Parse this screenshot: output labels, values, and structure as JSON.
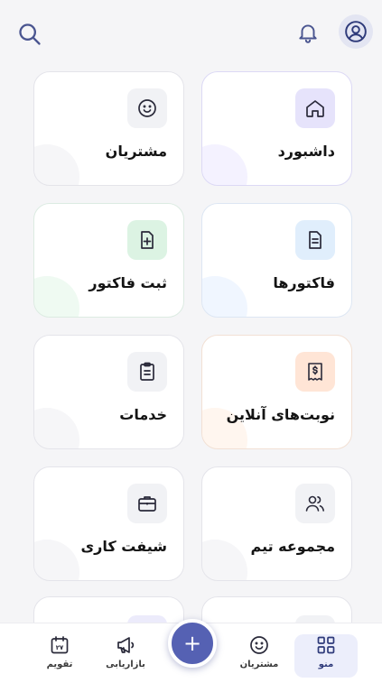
{
  "header": {
    "icons": [
      "search-icon",
      "bell-icon",
      "user-avatar-icon"
    ]
  },
  "menu": {
    "items": [
      {
        "label": "داشبورد",
        "icon": "home-icon",
        "accent": "#ecebff",
        "blob": "#eeecff"
      },
      {
        "label": "مشتریان",
        "icon": "smile-icon",
        "accent": "#f1f2f5",
        "blob": "#f0f1f4"
      },
      {
        "label": "فاکتورها",
        "icon": "document-icon",
        "accent": "#e2efff",
        "blob": "#e7f1ff"
      },
      {
        "label": "ثبت فاکتور",
        "icon": "document-plus-icon",
        "accent": "#e0f5e7",
        "blob": "#e6f6ea"
      },
      {
        "label": "نوبت‌های آنلاین",
        "icon": "receipt-dollar-icon",
        "accent": "#ffe7d9",
        "blob": "#fff0e6"
      },
      {
        "label": "خدمات",
        "icon": "clipboard-icon",
        "accent": "#f1f2f5",
        "blob": "#f0f1f4"
      },
      {
        "label": "مجموعه تیم",
        "icon": "users-icon",
        "accent": "#f1f2f5",
        "blob": "#f0f1f4"
      },
      {
        "label": "شیفت کاری",
        "icon": "briefcase-icon",
        "accent": "#f1f2f5",
        "blob": "#f0f1f4"
      }
    ]
  },
  "bottom_nav": {
    "items": [
      {
        "label": "منو",
        "icon": "grid-icon",
        "active": true
      },
      {
        "label": "مشتریان",
        "icon": "smile-icon",
        "active": false
      },
      {
        "label": "بازاریابی",
        "icon": "megaphone-icon",
        "active": false
      },
      {
        "label": "تقویم",
        "icon": "calendar-icon",
        "active": false
      }
    ],
    "fab_label": "+",
    "calendar_day": "۲۷"
  },
  "colors": {
    "primary": "#5561b3",
    "background": "#f5f5f7",
    "icon_stroke": "#2a2a3a"
  }
}
